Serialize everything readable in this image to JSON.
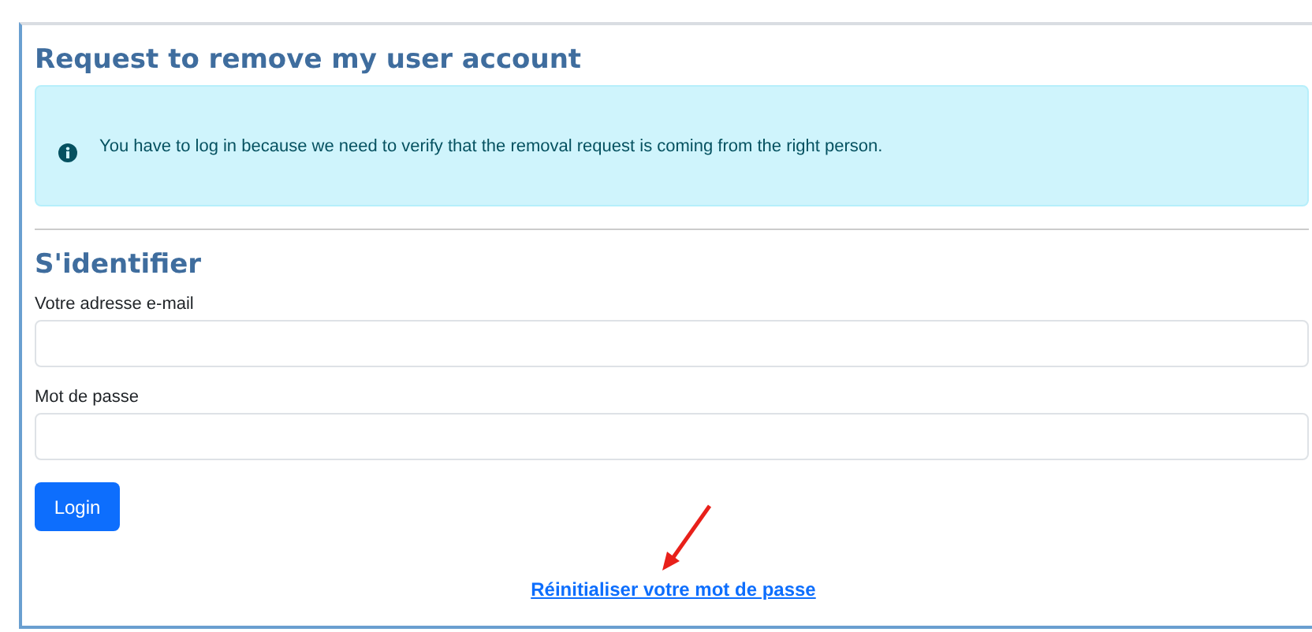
{
  "title": "Request to remove my user account",
  "alert": {
    "text": "You have to log in because we need to verify that the removal request is coming from the right person."
  },
  "section_title": "S'identifier",
  "fields": [
    {
      "label": "Votre adresse e-mail"
    },
    {
      "label": "Mot de passe"
    }
  ],
  "login_button": "Login",
  "reset_link": "Réinitialiser votre mot de passe"
}
